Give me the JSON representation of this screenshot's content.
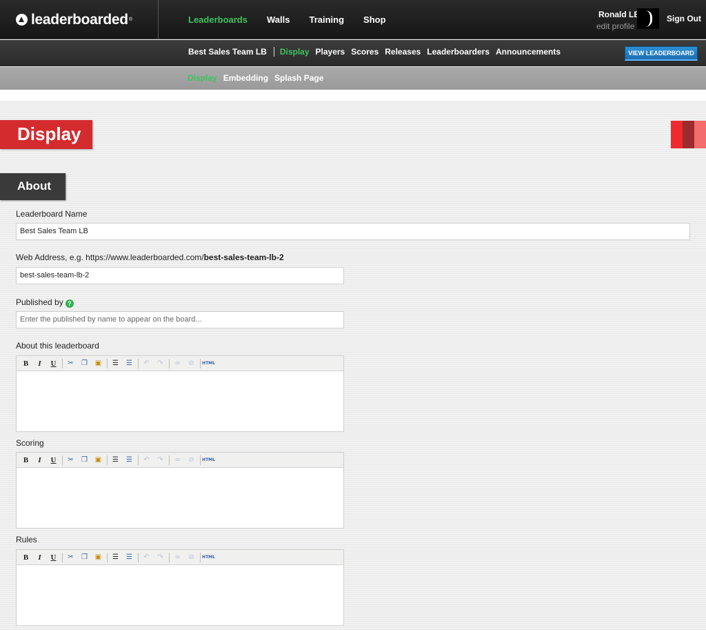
{
  "brand": {
    "name": "leaderboarded",
    "reg": "®"
  },
  "main_nav": [
    {
      "label": "Leaderboards",
      "active": true
    },
    {
      "label": "Walls",
      "active": false
    },
    {
      "label": "Training",
      "active": false
    },
    {
      "label": "Shop",
      "active": false
    }
  ],
  "user": {
    "name": "Ronald LB",
    "edit_label": "edit profile",
    "signout_label": "Sign Out"
  },
  "sub_nav": {
    "board_name": "Best Sales Team LB",
    "items": [
      {
        "label": "Display",
        "active": true
      },
      {
        "label": "Players",
        "active": false
      },
      {
        "label": "Scores",
        "active": false
      },
      {
        "label": "Releases",
        "active": false
      },
      {
        "label": "Leaderboarders",
        "active": false
      },
      {
        "label": "Announcements",
        "active": false
      }
    ],
    "view_button": "VIEW LEADERBOARD"
  },
  "third_nav": [
    {
      "label": "Display",
      "active": true
    },
    {
      "label": "Embedding",
      "active": false
    },
    {
      "label": "Splash Page",
      "active": false
    }
  ],
  "page": {
    "title": "Display",
    "section": "About"
  },
  "colors": {
    "accent_red": "#d42b2f",
    "active_green": "#3fc35d",
    "button_blue": "#1c6fb1"
  },
  "form": {
    "name_label": "Leaderboard Name",
    "name_value": "Best Sales Team LB",
    "web_label_prefix": "Web Address, e.g. https://www.leaderboarded.com/",
    "web_label_slug": "best-sales-team-lb-2",
    "web_value": "best-sales-team-lb-2",
    "published_label": "Published by",
    "published_help": "?",
    "published_placeholder": "Enter the published by name to appear on the board...",
    "about_label": "About this leaderboard",
    "scoring_label": "Scoring",
    "rules_label": "Rules"
  },
  "editor_toolbar": {
    "bold": "B",
    "italic": "I",
    "underline": "U",
    "cut_icon": "scissors-icon",
    "copy_icon": "copy-icon",
    "paste_icon": "paste-icon",
    "html": "HTML"
  }
}
